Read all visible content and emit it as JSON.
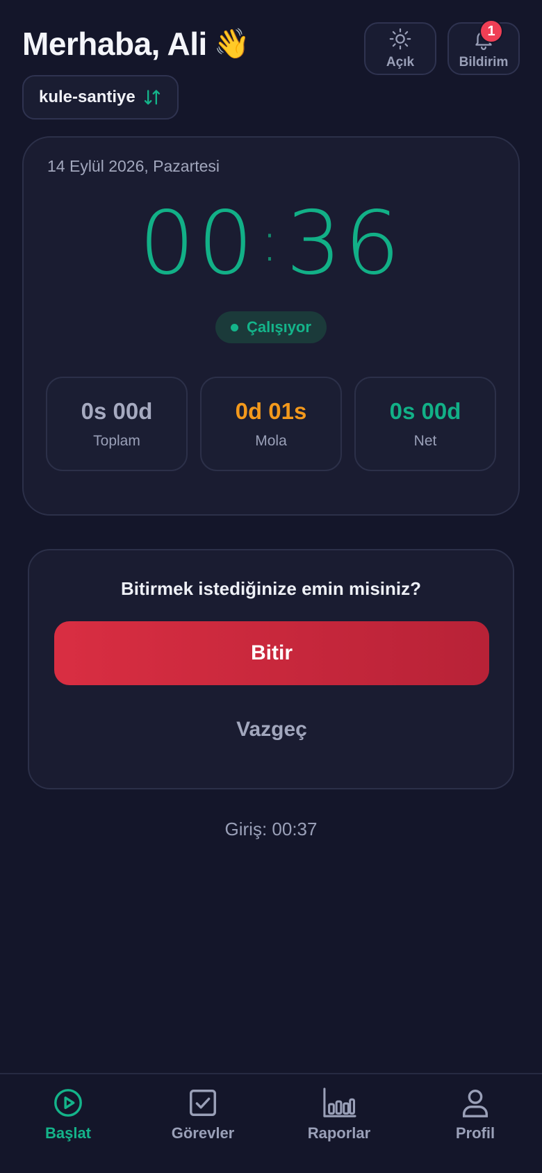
{
  "header": {
    "greeting": "Merhaba, Ali",
    "wave_emoji": "👋",
    "theme_label": "Açık",
    "notif_label": "Bildirim",
    "notif_count": "1",
    "project": "kule-santiye"
  },
  "timer": {
    "date": "14 Eylül 2026, Pazartesi",
    "hours": "00",
    "minutes": "36",
    "status": "Çalışıyor",
    "stats": [
      {
        "value": "0s 00d",
        "label": "Toplam"
      },
      {
        "value": "0d 01s",
        "label": "Mola"
      },
      {
        "value": "0s 00d",
        "label": "Net"
      }
    ]
  },
  "confirm": {
    "question": "Bitirmek istediğinize emin misiniz?",
    "finish_label": "Bitir",
    "cancel_label": "Vazgeç"
  },
  "login_time": "Giriş: 00:37",
  "nav": [
    {
      "label": "Başlat",
      "icon": "play-circle-icon"
    },
    {
      "label": "Görevler",
      "icon": "checkbox-icon"
    },
    {
      "label": "Raporlar",
      "icon": "bar-chart-icon"
    },
    {
      "label": "Profil",
      "icon": "user-icon"
    }
  ],
  "colors": {
    "background": "#14162a",
    "accent_green": "#12b087",
    "break_orange": "#f3991c",
    "danger_red": "#d92e42"
  }
}
